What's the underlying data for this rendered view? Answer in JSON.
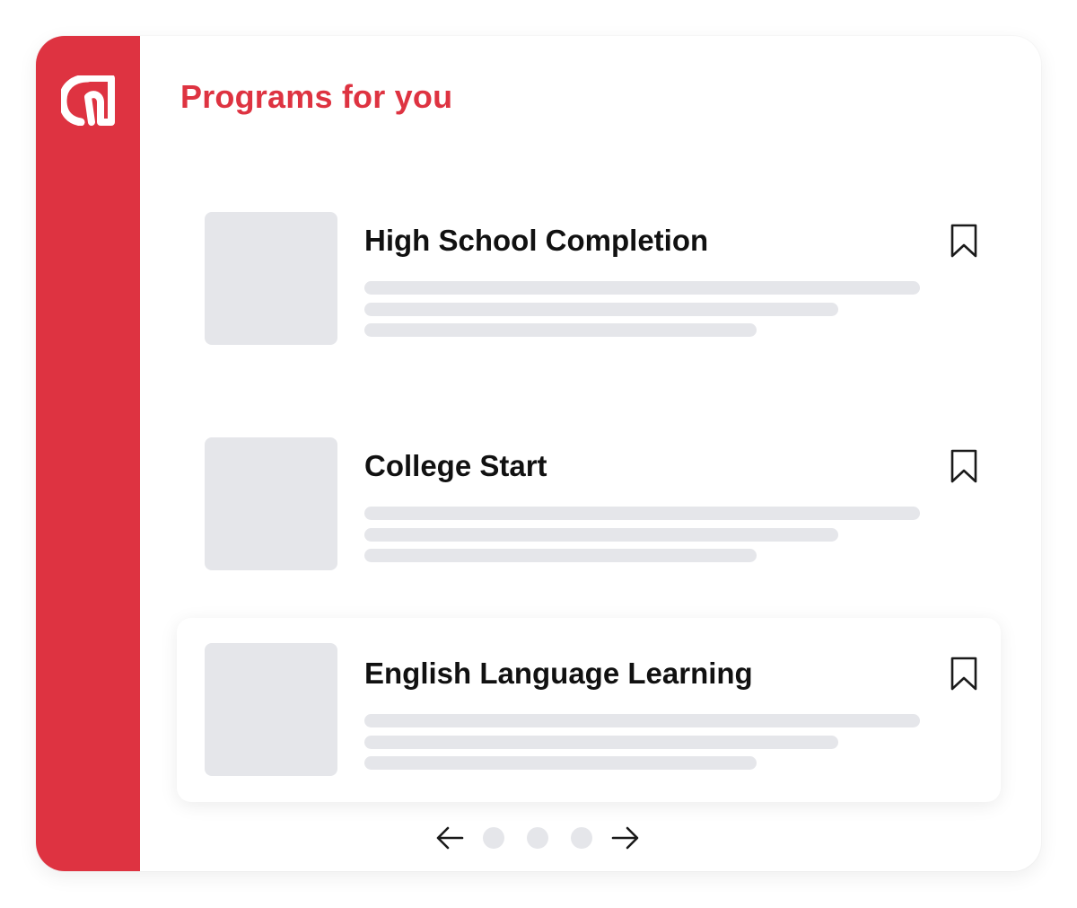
{
  "colors": {
    "brand_red": "#DE3341",
    "placeholder_gray": "#E5E6EA",
    "title_text": "#111111",
    "icon_stroke": "#1A1A1A"
  },
  "sidebar": {
    "logo_icon": "g-logo-icon"
  },
  "heading": "Programs for you",
  "programs": [
    {
      "title": "High School Completion",
      "bookmark_icon": "bookmark-icon",
      "highlighted": false
    },
    {
      "title": "College Start",
      "bookmark_icon": "bookmark-icon",
      "highlighted": false
    },
    {
      "title": "English Language Learning",
      "bookmark_icon": "bookmark-icon",
      "highlighted": true
    }
  ],
  "pagination": {
    "prev_icon": "arrow-left-icon",
    "next_icon": "arrow-right-icon",
    "dot_count": 3
  }
}
